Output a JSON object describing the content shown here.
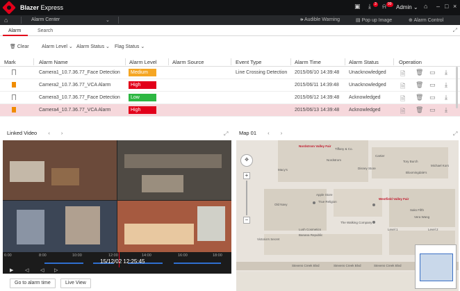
{
  "app": {
    "brand": "Blazer",
    "product": "Express",
    "user": "Admin"
  },
  "nav": {
    "current": "Alarm Center",
    "items": [
      "Audible Warning",
      "Pop up Image",
      "Alarm Control"
    ]
  },
  "badges": {
    "download": "3",
    "alarms": "99"
  },
  "tabs": [
    "Alarm",
    "Search"
  ],
  "filters": {
    "clear": "Clear",
    "level": "Alarm Level",
    "status": "Alarm Status",
    "flag": "Flag Status"
  },
  "table": {
    "columns": [
      "Mark",
      "Alarm Name",
      "Alarm Level",
      "Alarm Source",
      "Event Type",
      "Alarm Time",
      "Alarm Status",
      "Operation"
    ],
    "rows": [
      {
        "name": "Camera1_10.7.36.77_Face Detection",
        "level": "Medium",
        "level_color": "#f5a623",
        "source": "",
        "event": "Line Crossing Detection",
        "time": "2015/06/10 14:39:48",
        "status": "Unacknowledged",
        "flagged": false
      },
      {
        "name": "Camera2_10.7.36.77_VCA Alarm",
        "level": "High",
        "level_color": "#e2001a",
        "source": "",
        "event": "",
        "time": "2015/06/11 14:39:48",
        "status": "Unacknowledged",
        "flagged": true
      },
      {
        "name": "Camera3_10.7.36.77_Face Detection",
        "level": "Low",
        "level_color": "#2db742",
        "source": "",
        "event": "",
        "time": "2015/06/12 14:39:48",
        "status": "Acknowledged",
        "flagged": false
      },
      {
        "name": "Camera4_10.7.36.77_VCA Alarm",
        "level": "High",
        "level_color": "#e2001a",
        "source": "",
        "event": "",
        "time": "2015/06/13 14:39:48",
        "status": "Acknowledged",
        "flagged": true
      }
    ]
  },
  "linked_video": {
    "title": "Linked Video",
    "timeline": {
      "labels": [
        "6:00",
        "8:00",
        "10:00",
        "12:00",
        "14:00",
        "16:00",
        "18:00"
      ],
      "current_time": "15/12/02 12:25:45"
    }
  },
  "map": {
    "title": "Map 01",
    "labels": [
      "Nordstrom Valley Fair",
      "Tiffany & Co.",
      "Cartier",
      "Tory Burch",
      "Old Navy",
      "Apple Store",
      "True Religion",
      "Westfield Valley Fair",
      "The Walking Company",
      "Level 1",
      "Macy's",
      "Nordstrom",
      "Disney Store",
      "Bloomingdale's",
      "Lush Cosmetics",
      "Banana Republic",
      "Victoria's Secret",
      "Saks Fifth",
      "Vera Wang",
      "Michael Kors",
      "Level 2"
    ],
    "streets": [
      "Stevens Creek Blvd",
      "Stevens Creek Blvd",
      "Stevens Creek Blvd"
    ]
  },
  "buttons": {
    "go_to_alarm": "Go to alarm time",
    "live_view": "Live View"
  },
  "colors": {
    "accent": "#e2001a",
    "titlebar": "#111214",
    "highlight_row": "#f6d8dc"
  }
}
